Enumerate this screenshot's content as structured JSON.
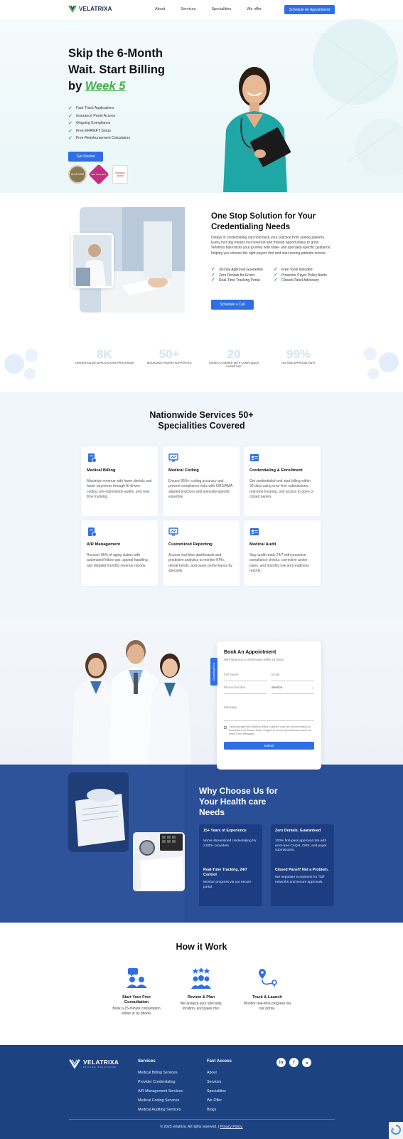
{
  "nav": {
    "brand": "VELATRIXA",
    "links": [
      "About",
      "Services",
      "Specialities",
      "We offer"
    ],
    "cta": "Schedule An Appointment"
  },
  "hero": {
    "title_line1": "Skip the 6-Month",
    "title_line2": "Wait. Start Billing",
    "title_line3_prefix": "by ",
    "title_accent": "Week 5",
    "checks": [
      "Fast-Track Applications",
      "Insurance Panel Access",
      "Ongoing Compliance",
      "Free ERA/EFT Setup",
      "Free Reimbursement Calculators"
    ],
    "button": "Get Started",
    "badges": [
      "ELAS 2025",
      "Best Cloud 2025",
      "Software Award"
    ]
  },
  "onestop": {
    "title": "One Stop Solution for Your Credentialing Needs",
    "paragraph": "Delays in credentialing can hold back your practice from seeing patients. Every lost day means lost revenue and missed opportunities to grow. Velatrixa fast-tracks your journey with state- and specialty-specific guidance, helping you choose the right payers first and start seeing patients sooner.",
    "features": [
      "30-Day Approval Guarantee",
      "Free Tools Included",
      "Zero Denials for Errors",
      "Proactive Payer Policy Alerts",
      "Real-Time Tracking Portal",
      "Closed-Panel Advocacy"
    ],
    "button": "Schedule a Call"
  },
  "stats": [
    {
      "num": "8K",
      "label": "CREDENTIALING APPLICATIONS PROCESSED"
    },
    {
      "num": "50+",
      "label": "INSURANCE PAYERS SUPPORTED"
    },
    {
      "num": "20",
      "label": "STATES COVERED WITH COMPLIANCE EXPERTISE"
    },
    {
      "num": "99%",
      "label": "ON-TIME APPROVAL RATE"
    }
  ],
  "services": {
    "title_line1": "Nationwide Services 50+",
    "title_line2": "Specialities Covered",
    "cards": [
      {
        "icon": "billing-icon",
        "title": "Medical Billing",
        "desc": "Maximize revenue with fewer denials and faster payments through AI-driven coding, pre-submission audits, and real-time tracking."
      },
      {
        "icon": "monitor-icon",
        "title": "Medical Coding",
        "desc": "Ensure 95%+ coding accuracy and prevent compliance risks with CMS/AMA-aligned practices and specialty-specific expertise."
      },
      {
        "icon": "id-card-icon",
        "title": "Credentialing & Enrollment",
        "desc": "Get credentialed and start billing within 30 days using error-free submissions, real-time tracking, and access to open or closed panels."
      },
      {
        "icon": "billing-icon",
        "title": "A/R Management",
        "desc": "Recover 85% of aging claims with automated follow-ups, appeal handling, and detailed monthly revenue reports."
      },
      {
        "icon": "monitor-icon",
        "title": "Customized Reporting",
        "desc": "Access real-time dashboards and predictive analytics to monitor KPIs, denial trends, and payer performance by specialty."
      },
      {
        "icon": "id-card-icon",
        "title": "Medical Audit",
        "desc": "Stay audit-ready 24/7 with proactive compliance checks, corrective action plans, and monthly risk and readiness reports."
      }
    ]
  },
  "appointment": {
    "tab": "Consulting Free",
    "title": "Book An Appointment",
    "subtitle": "We'll send you a confirmation within 24 hours.",
    "full_name": "Full Name",
    "email": "Email",
    "phone": "Phone Number",
    "service": "Service",
    "message": "Message",
    "consent": "I acknowledge that Velatrixa Billing Solutions may use my information as described in its Privacy Policy & Agree to receive promotional content via email & text messages.",
    "submit": "Submit"
  },
  "why": {
    "title_line1": "Why Choose Us for",
    "title_line2": "Your Health care",
    "title_line3": "Needs",
    "cards": [
      {
        "title": "15+ Years of Experience",
        "desc": "We've streamlined credentialing for 2,000+ providers."
      },
      {
        "title": "Zero Denials. Guaranteed",
        "desc": "100% first-pass approval rate with error-free CAQH, CMS, and payer submissions."
      },
      {
        "title": "Real-Time Tracking, 24/7 Control",
        "desc": "Monitor progress via our secure portal."
      },
      {
        "title": "Closed Panel? Not a Problem.",
        "desc": "We negotiate exceptions for \"full\" networks and secure approvals."
      }
    ]
  },
  "how": {
    "title": "How it Work",
    "steps": [
      {
        "icon": "consultation-icon",
        "title": "Start Your Free Consultation",
        "desc": "Book a 15-minute consultation online or by phone."
      },
      {
        "icon": "review-icon",
        "title": "Review & Plan",
        "desc": "We analyze your specialty, location, and payer mix."
      },
      {
        "icon": "route-icon",
        "title": "Track & Launch",
        "desc": "Monitor real-time progress via our portal."
      }
    ]
  },
  "footer": {
    "brand": "VELATRIXA",
    "brand_sub": "BILLING SOLUTIONS",
    "services_title": "Services",
    "services": [
      "Medical Billing Services",
      "Provider Credentialing",
      "A/R Management Services",
      "Medical Coding Services",
      "Medical Auditing Services"
    ],
    "access_title": "Fast Access",
    "access": [
      "About",
      "Services",
      "Specialities",
      "We Offer",
      "Blogs"
    ],
    "social": [
      "in",
      "f",
      "ig"
    ],
    "copyright": "© 2025 velatrixa. All rights reserved. |",
    "privacy": "Privacy Policy."
  },
  "colors": {
    "primary": "#2f6fe6",
    "accent_green": "#3fae49",
    "navy": "#1c4282",
    "why_bg": "#2b4f97"
  }
}
